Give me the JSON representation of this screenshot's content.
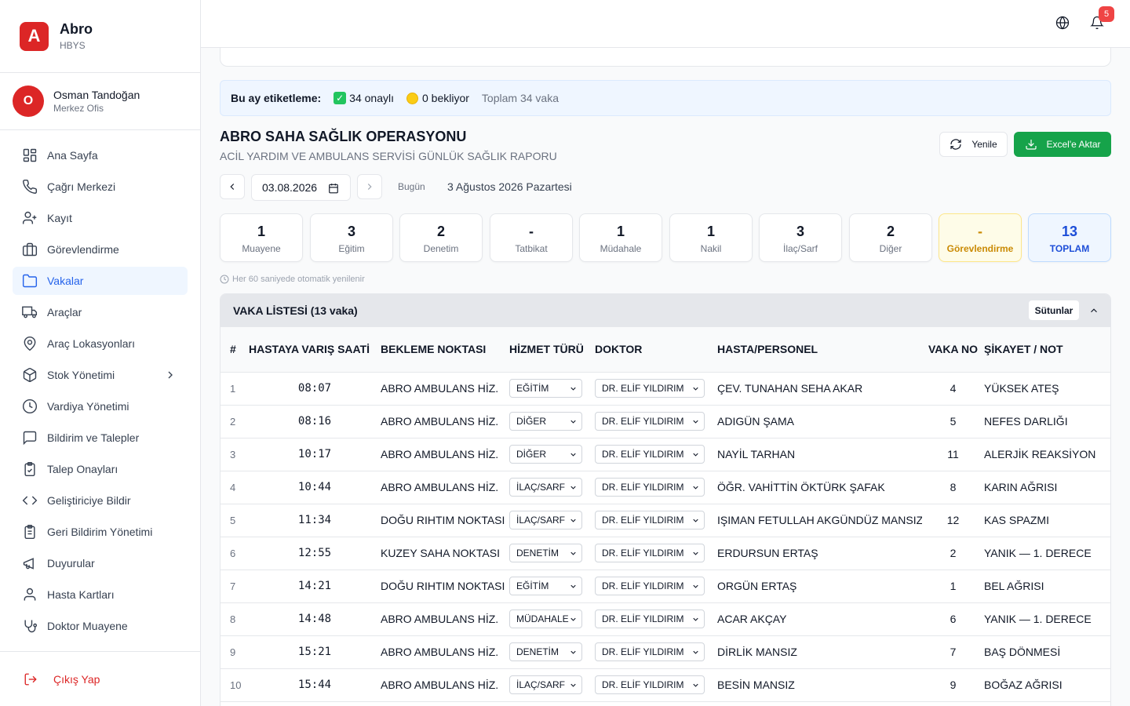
{
  "brand": {
    "logo_letter": "A",
    "name": "Abro",
    "sub": "HBYS"
  },
  "user": {
    "initial": "O",
    "name": "Osman Tandoğan",
    "role": "Merkez Ofis"
  },
  "sidebar": {
    "items": [
      {
        "label": "Ana Sayfa",
        "icon": "grid-icon"
      },
      {
        "label": "Çağrı Merkezi",
        "icon": "phone-icon"
      },
      {
        "label": "Kayıt",
        "icon": "user-plus-icon"
      },
      {
        "label": "Görevlendirme",
        "icon": "briefcase-icon"
      },
      {
        "label": "Vakalar",
        "icon": "folder-icon",
        "active": true
      },
      {
        "label": "Araçlar",
        "icon": "truck-icon"
      },
      {
        "label": "Araç Lokasyonları",
        "icon": "map-pin-icon"
      },
      {
        "label": "Stok Yönetimi",
        "icon": "box-icon",
        "has_children": true
      },
      {
        "label": "Vardiya Yönetimi",
        "icon": "clock-icon"
      },
      {
        "label": "Bildirim ve Talepler",
        "icon": "message-icon"
      },
      {
        "label": "Talep Onayları",
        "icon": "clipboard-check-icon"
      },
      {
        "label": "Geliştiriciye Bildir",
        "icon": "code-icon"
      },
      {
        "label": "Geri Bildirim Yönetimi",
        "icon": "clipboard-list-icon"
      },
      {
        "label": "Duyurular",
        "icon": "megaphone-icon"
      },
      {
        "label": "Hasta Kartları",
        "icon": "user-icon"
      },
      {
        "label": "Doktor Muayene",
        "icon": "stethoscope-icon"
      }
    ],
    "logout": "Çıkış Yap"
  },
  "header": {
    "notification_count": "5"
  },
  "banner": {
    "title": "Bu ay etiketleme:",
    "approved": "34 onaylı",
    "pending": "0 bekliyor",
    "total": "Toplam 34 vaka"
  },
  "page": {
    "title": "ABRO SAHA SAĞLIK OPERASYONU",
    "subtitle": "ACİL YARDIM VE AMBULANS SERVİSİ GÜNLÜK SAĞLIK RAPORU",
    "refresh_label": "Yenile",
    "excel_label": "Excel'e Aktar"
  },
  "datebar": {
    "date": "03.08.2026",
    "today_label": "Bugün",
    "full_date": "3 Ağustos 2026 Pazartesi"
  },
  "stats": [
    {
      "value": "1",
      "label": "Muayene"
    },
    {
      "value": "3",
      "label": "Eğitim"
    },
    {
      "value": "2",
      "label": "Denetim"
    },
    {
      "value": "-",
      "label": "Tatbikat"
    },
    {
      "value": "1",
      "label": "Müdahale"
    },
    {
      "value": "1",
      "label": "Nakil"
    },
    {
      "value": "3",
      "label": "İlaç/Sarf"
    },
    {
      "value": "2",
      "label": "Diğer"
    },
    {
      "value": "-",
      "label": "Görevlendirme",
      "style": "yellow"
    },
    {
      "value": "13",
      "label": "TOPLAM",
      "style": "blue"
    }
  ],
  "autorefresh": "Her 60 saniyede otomatik yenilenir",
  "table": {
    "title": "VAKA LİSTESİ (13 vaka)",
    "columns_button": "Sütunlar",
    "headers": [
      "#",
      "HASTAYA VARIŞ SAATİ",
      "BEKLEME NOKTASI",
      "HİZMET TÜRÜ",
      "DOKTOR",
      "HASTA/PERSONEL",
      "VAKA NO",
      "ŞİKAYET / NOT"
    ],
    "rows": [
      {
        "n": "1",
        "time": "08:07",
        "point": "ABRO AMBULANS HİZ.",
        "service": "EĞİTİM",
        "doctor": "DR. ELİF YILDIRIM",
        "patient": "ÇEV. TUNAHAN SEHA AKAR",
        "case_no": "4",
        "note": "YÜKSEK ATEŞ"
      },
      {
        "n": "2",
        "time": "08:16",
        "point": "ABRO AMBULANS HİZ.",
        "service": "DİĞER",
        "doctor": "DR. ELİF YILDIRIM",
        "patient": "ADIGÜN ŞAMA",
        "case_no": "5",
        "note": "NEFES DARLIĞI"
      },
      {
        "n": "3",
        "time": "10:17",
        "point": "ABRO AMBULANS HİZ.",
        "service": "DİĞER",
        "doctor": "DR. ELİF YILDIRIM",
        "patient": "NAYİL TARHAN",
        "case_no": "11",
        "note": "ALERJİK REAKSİYON"
      },
      {
        "n": "4",
        "time": "10:44",
        "point": "ABRO AMBULANS HİZ.",
        "service": "İLAÇ/SARF",
        "doctor": "DR. ELİF YILDIRIM",
        "patient": "ÖĞR. VAHİTTİN ÖKTÜRK ŞAFAK",
        "case_no": "8",
        "note": "KARIN AĞRISI"
      },
      {
        "n": "5",
        "time": "11:34",
        "point": "DOĞU RIHTIM NOKTASI",
        "service": "İLAÇ/SARF",
        "doctor": "DR. ELİF YILDIRIM",
        "patient": "IŞIMAN FETULLAH AKGÜNDÜZ MANSIZ",
        "case_no": "12",
        "note": "KAS SPAZMI"
      },
      {
        "n": "6",
        "time": "12:55",
        "point": "KUZEY SAHA NOKTASI",
        "service": "DENETİM",
        "doctor": "DR. ELİF YILDIRIM",
        "patient": "ERDURSUN ERTAŞ",
        "case_no": "2",
        "note": "YANIK — 1. DERECE"
      },
      {
        "n": "7",
        "time": "14:21",
        "point": "DOĞU RIHTIM NOKTASI",
        "service": "EĞİTİM",
        "doctor": "DR. ELİF YILDIRIM",
        "patient": "ORGÜN ERTAŞ",
        "case_no": "1",
        "note": "BEL AĞRISI"
      },
      {
        "n": "8",
        "time": "14:48",
        "point": "ABRO AMBULANS HİZ.",
        "service": "MÜDAHALE",
        "doctor": "DR. ELİF YILDIRIM",
        "patient": "ACAR AKÇAY",
        "case_no": "6",
        "note": "YANIK — 1. DERECE"
      },
      {
        "n": "9",
        "time": "15:21",
        "point": "ABRO AMBULANS HİZ.",
        "service": "DENETİM",
        "doctor": "DR. ELİF YILDIRIM",
        "patient": "DİRLİK MANSIZ",
        "case_no": "7",
        "note": "BAŞ DÖNMESİ"
      },
      {
        "n": "10",
        "time": "15:44",
        "point": "ABRO AMBULANS HİZ.",
        "service": "İLAÇ/SARF",
        "doctor": "DR. ELİF YILDIRIM",
        "patient": "BESİN MANSIZ",
        "case_no": "9",
        "note": "BOĞAZ AĞRISI"
      }
    ]
  }
}
